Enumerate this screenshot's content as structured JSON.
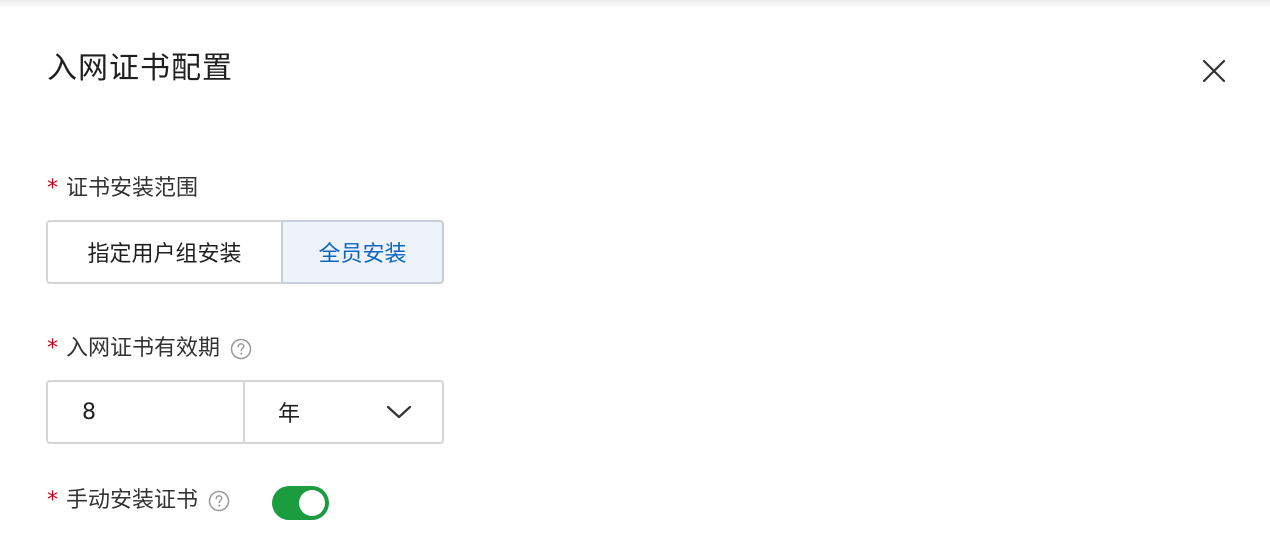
{
  "dialog": {
    "title": "入网证书配置"
  },
  "fields": {
    "scope": {
      "required_mark": "*",
      "label": "证书安装范围",
      "options": [
        "指定用户组安装",
        "全员安装"
      ],
      "selected": "全员安装"
    },
    "validity": {
      "required_mark": "*",
      "label": "入网证书有效期",
      "value": "8",
      "unit": "年"
    },
    "manual_install": {
      "required_mark": "*",
      "label": "手动安装证书",
      "enabled": true
    }
  },
  "icons": {
    "close": "close-icon",
    "help": "help-circle-icon",
    "dropdown": "chevron-down-icon"
  },
  "colors": {
    "required": "#d9001b",
    "selected_text": "#0b66c3",
    "selected_bg": "#eef2fb",
    "toggle_on": "#1a9c3f"
  }
}
